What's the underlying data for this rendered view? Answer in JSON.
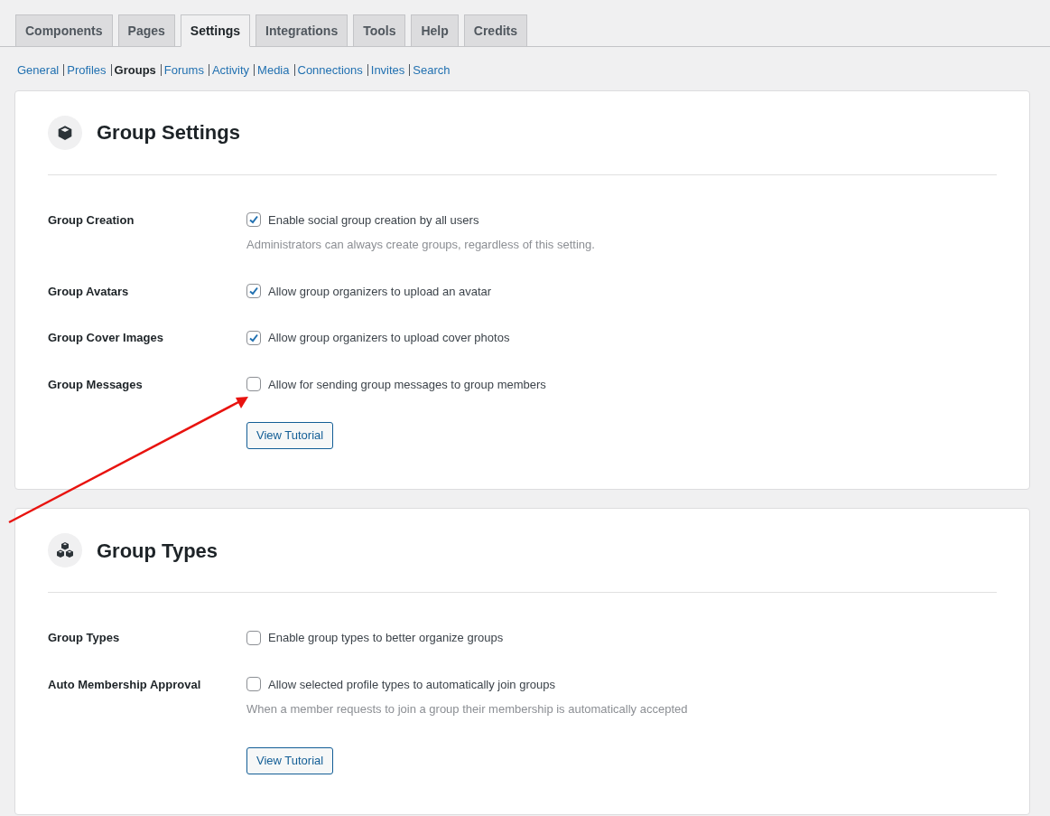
{
  "tabs": [
    {
      "label": "Components",
      "selected": false
    },
    {
      "label": "Pages",
      "selected": false
    },
    {
      "label": "Settings",
      "selected": true
    },
    {
      "label": "Integrations",
      "selected": false
    },
    {
      "label": "Tools",
      "selected": false
    },
    {
      "label": "Help",
      "selected": false
    },
    {
      "label": "Credits",
      "selected": false
    }
  ],
  "subnav": [
    {
      "label": "General",
      "selected": false
    },
    {
      "label": "Profiles",
      "selected": false
    },
    {
      "label": "Groups",
      "selected": true
    },
    {
      "label": "Forums",
      "selected": false
    },
    {
      "label": "Activity",
      "selected": false
    },
    {
      "label": "Media",
      "selected": false
    },
    {
      "label": "Connections",
      "selected": false
    },
    {
      "label": "Invites",
      "selected": false
    },
    {
      "label": "Search",
      "selected": false
    }
  ],
  "sections": [
    {
      "title": "Group Settings",
      "rows": [
        {
          "label": "Group Creation",
          "option": "Enable social group creation by all users",
          "checked": true,
          "description": "Administrators can always create groups, regardless of this setting."
        },
        {
          "label": "Group Avatars",
          "option": "Allow group organizers to upload an avatar",
          "checked": true
        },
        {
          "label": "Group Cover Images",
          "option": "Allow group organizers to upload cover photos",
          "checked": true
        },
        {
          "label": "Group Messages",
          "option": "Allow for sending group messages to group members",
          "checked": false
        }
      ],
      "button": "View Tutorial"
    },
    {
      "title": "Group Types",
      "rows": [
        {
          "label": "Group Types",
          "option": "Enable group types to better organize groups",
          "checked": false
        },
        {
          "label": "Auto Membership Approval",
          "option": "Allow selected profile types to automatically join groups",
          "checked": false,
          "description": "When a member requests to join a group their membership is automatically accepted"
        }
      ],
      "button": "View Tutorial"
    }
  ]
}
